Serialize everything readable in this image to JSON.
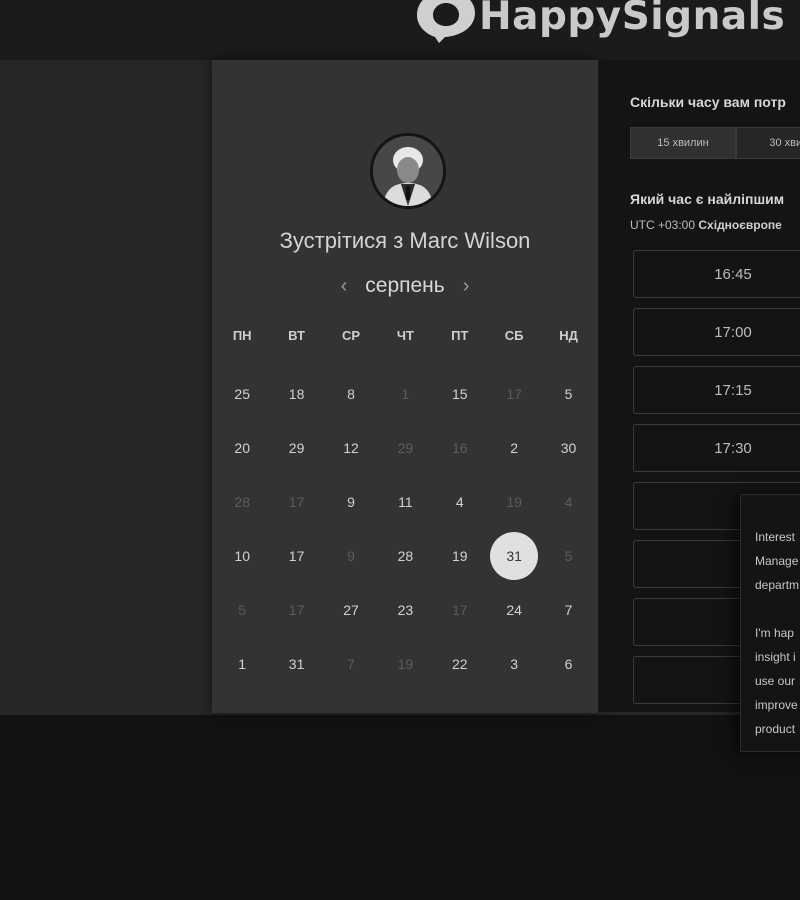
{
  "brand": {
    "name": "HappySignals"
  },
  "scheduler": {
    "title": "Зустрітися з Marc Wilson",
    "month": "серпень",
    "weekdays": [
      "ПН",
      "ВТ",
      "СР",
      "ЧТ",
      "ПТ",
      "СБ",
      "НД"
    ],
    "days": [
      {
        "d": "25",
        "dim": false
      },
      {
        "d": "18",
        "dim": false
      },
      {
        "d": "8",
        "dim": false
      },
      {
        "d": "1",
        "dim": true
      },
      {
        "d": "15",
        "dim": false
      },
      {
        "d": "17",
        "dim": true
      },
      {
        "d": "5",
        "dim": false
      },
      {
        "d": "20",
        "dim": false
      },
      {
        "d": "29",
        "dim": false
      },
      {
        "d": "12",
        "dim": false
      },
      {
        "d": "29",
        "dim": true
      },
      {
        "d": "16",
        "dim": true
      },
      {
        "d": "2",
        "dim": false
      },
      {
        "d": "30",
        "dim": false
      },
      {
        "d": "28",
        "dim": true
      },
      {
        "d": "17",
        "dim": true
      },
      {
        "d": "9",
        "dim": false
      },
      {
        "d": "11",
        "dim": false
      },
      {
        "d": "4",
        "dim": false
      },
      {
        "d": "19",
        "dim": true
      },
      {
        "d": "4",
        "dim": true
      },
      {
        "d": "10",
        "dim": false
      },
      {
        "d": "17",
        "dim": false
      },
      {
        "d": "9",
        "dim": true
      },
      {
        "d": "28",
        "dim": false
      },
      {
        "d": "19",
        "dim": false
      },
      {
        "d": "31",
        "dim": false,
        "selected": true
      },
      {
        "d": "5",
        "dim": true
      },
      {
        "d": "5",
        "dim": true
      },
      {
        "d": "17",
        "dim": true
      },
      {
        "d": "27",
        "dim": false
      },
      {
        "d": "23",
        "dim": false
      },
      {
        "d": "17",
        "dim": true
      },
      {
        "d": "24",
        "dim": false
      },
      {
        "d": "7",
        "dim": false
      },
      {
        "d": "1",
        "dim": false
      },
      {
        "d": "31",
        "dim": false
      },
      {
        "d": "7",
        "dim": true
      },
      {
        "d": "19",
        "dim": true
      },
      {
        "d": "22",
        "dim": false
      },
      {
        "d": "3",
        "dim": false
      },
      {
        "d": "6",
        "dim": false
      }
    ]
  },
  "booking": {
    "duration_question": "Скільки часу вам потр",
    "durations": [
      "15 хвилин",
      "30 хвил"
    ],
    "time_question": "Який час є найліпшим",
    "timezone_offset": "UTC +03:00",
    "timezone_name": "Східноєвропе",
    "slots": [
      "16:45",
      "17:00",
      "17:15",
      "17:30",
      "",
      "",
      "",
      ""
    ]
  },
  "popup": {
    "paragraph1": "Interest\nManage\ndepartm",
    "paragraph2": "I'm hap\ninsight i\nuse our\nimprove\nproduct"
  }
}
